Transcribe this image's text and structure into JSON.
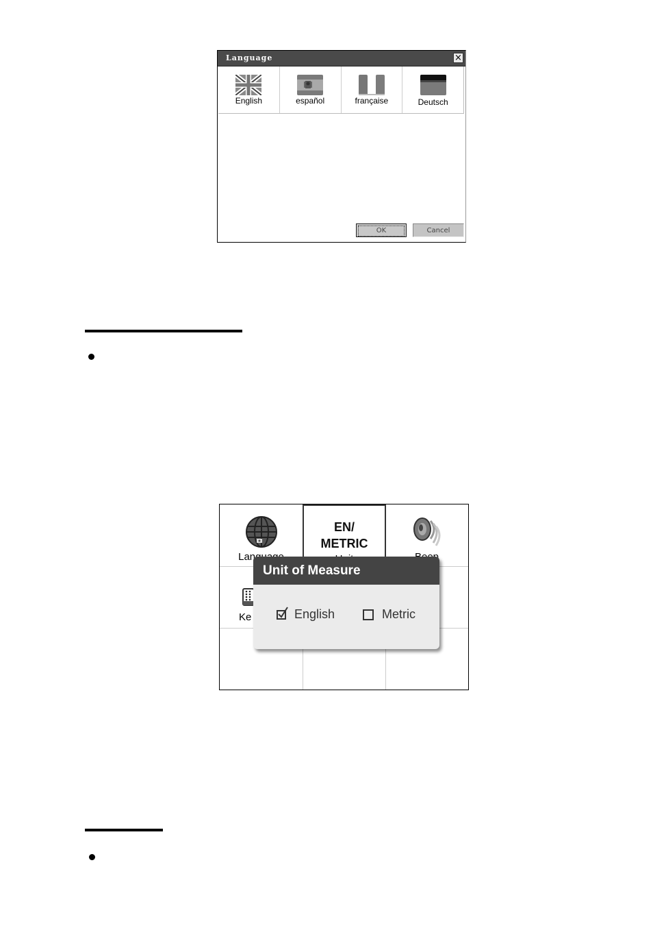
{
  "language_dialog": {
    "title": "Language",
    "close_icon": "close-icon",
    "languages": [
      {
        "label": "English",
        "flag": "uk-flag-icon"
      },
      {
        "label": "español",
        "flag": "spain-flag-icon"
      },
      {
        "label": "française",
        "flag": "france-flag-icon"
      },
      {
        "label": "Deutsch",
        "flag": "germany-flag-icon"
      }
    ],
    "ok_label": "OK",
    "cancel_label": "Cancel"
  },
  "settings_menu": {
    "tiles": [
      {
        "label": "Language",
        "icon": "globe-icon"
      },
      {
        "label": "Unit",
        "icon_text_line1": "EN/",
        "icon_text_line2": "METRIC",
        "selected": true
      },
      {
        "label": "Beep",
        "icon": "speaker-icon"
      },
      {
        "label": "Ke",
        "icon": "keypad-icon"
      }
    ]
  },
  "unit_popup": {
    "title": "Unit of Measure",
    "options": [
      {
        "label": "English",
        "checked": true
      },
      {
        "label": "Metric",
        "checked": false
      }
    ]
  },
  "colors": {
    "title_bar": "#4a4a4a",
    "popup_header": "#444444",
    "popup_body": "#ebebeb"
  }
}
